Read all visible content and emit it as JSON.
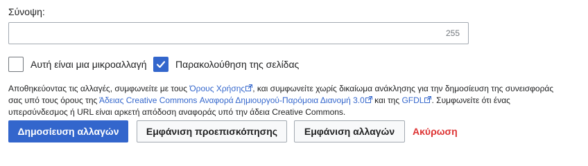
{
  "summary": {
    "label": "Σύνοψη:",
    "value": "",
    "char_count": "255"
  },
  "checkboxes": {
    "minor_edit": {
      "label": "Αυτή είναι μια μικροαλλαγή",
      "checked": false
    },
    "watch_page": {
      "label": "Παρακολούθηση της σελίδας",
      "checked": true
    }
  },
  "legal": {
    "part1": "Αποθηκεύοντας τις αλλαγές, συμφωνείτε με τους ",
    "terms_link": "Όρους Χρήσης",
    "part2": ", και συμφωνείτε χωρίς δικαίωμα ανάκλησης για την δημοσίευση της συνεισφοράς σας υπό τους όρους της ",
    "license_link": "Άδειας Creative Commons Αναφορά Δημιουργού-Παρόμοια Διανομή 3.0",
    "part3": " και της ",
    "gfdl_link": "GFDL",
    "part4": ". Συμφωνείτε ότι ένας υπερσύνδεσμος ή URL είναι αρκετή απόδοση αναφοράς υπό την άδεια Creative Commons."
  },
  "actions": {
    "save_label": "Δημοσίευση αλλαγών",
    "preview_label": "Εμφάνιση προεπισκόπησης",
    "diff_label": "Εμφάνιση αλλαγών",
    "cancel_label": "Ακύρωση"
  },
  "colors": {
    "accent": "#3366cc",
    "cancel": "#dd3333",
    "text": "#202122"
  }
}
